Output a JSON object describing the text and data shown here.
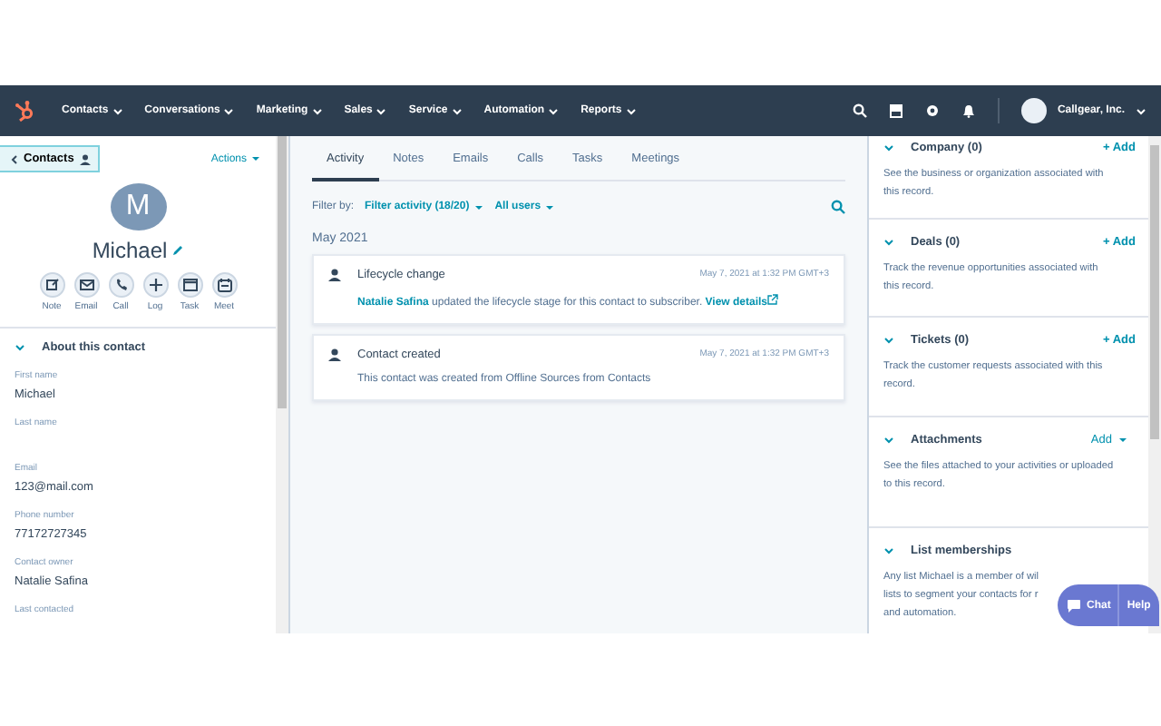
{
  "nav": {
    "menu": [
      {
        "label": "Contacts"
      },
      {
        "label": "Conversations"
      },
      {
        "label": "Marketing"
      },
      {
        "label": "Sales"
      },
      {
        "label": "Service"
      },
      {
        "label": "Automation"
      },
      {
        "label": "Reports"
      }
    ],
    "account": "Callgear, Inc."
  },
  "contact": {
    "back": "Contacts",
    "actions": "Actions",
    "initial": "M",
    "name": "Michael",
    "quick_actions": [
      {
        "label": "Note",
        "kind": "note"
      },
      {
        "label": "Email",
        "kind": "email"
      },
      {
        "label": "Call",
        "kind": "call"
      },
      {
        "label": "Log",
        "kind": "log"
      },
      {
        "label": "Task",
        "kind": "task"
      },
      {
        "label": "Meet",
        "kind": "meet"
      }
    ],
    "about": {
      "title": "About this contact",
      "expanded": true,
      "fields": [
        {
          "label": "First name",
          "value": "Michael"
        },
        {
          "label": "Last name"
        },
        {
          "label": "Email",
          "value": "123@mail.com"
        },
        {
          "label": "Phone number",
          "value": "77172727345"
        },
        {
          "label": "Contact owner",
          "value": "Natalie Safina"
        },
        {
          "label": "Last contacted"
        }
      ]
    }
  },
  "activity": {
    "tabs": [
      {
        "label": "Activity",
        "selected": true
      },
      {
        "label": "Notes",
        "selected": false
      },
      {
        "label": "Emails",
        "selected": false
      },
      {
        "label": "Calls",
        "selected": false
      },
      {
        "label": "Tasks",
        "selected": false
      },
      {
        "label": "Meetings",
        "selected": false
      }
    ],
    "filter_label": "Filter by:",
    "filters": [
      "Filter activity (18/20)",
      "All users"
    ],
    "month": "May 2021",
    "items": [
      {
        "title": "Lifecycle change",
        "time": "May 7, 2021 at 1:32 PM GMT+3",
        "actor": "Natalie Safina",
        "text": "updated the lifecycle stage for this contact to subscriber.",
        "link": "View details"
      },
      {
        "title": "Contact created",
        "time": "May 7, 2021 at 1:32 PM GMT+3",
        "text": "This contact was created from Offline Sources from Contacts"
      }
    ]
  },
  "sidebar": {
    "sections": [
      {
        "title": "Company (0)",
        "expanded": true,
        "action": "+ Add",
        "kind": "add",
        "lines": [
          "See the business or organization associated with",
          "this record."
        ]
      },
      {
        "title": "Deals (0)",
        "expanded": true,
        "action": "+ Add",
        "kind": "add",
        "lines": [
          "Track the revenue opportunities associated with",
          "this record."
        ]
      },
      {
        "title": "Tickets (0)",
        "expanded": true,
        "action": "+ Add",
        "kind": "add",
        "lines": [
          "Track the customer requests associated with this",
          "record."
        ]
      },
      {
        "title": "Attachments",
        "expanded": true,
        "action": "Add",
        "kind": "dropdown",
        "lines": [
          "See the files attached to your activities or uploaded",
          "to this record."
        ]
      },
      {
        "title": "List memberships",
        "expanded": true,
        "lines": [
          "Any list Michael is a member of wil",
          "lists to segment your contacts for r",
          "and automation."
        ]
      }
    ]
  },
  "chat": {
    "chat": "Chat",
    "help": "Help"
  }
}
